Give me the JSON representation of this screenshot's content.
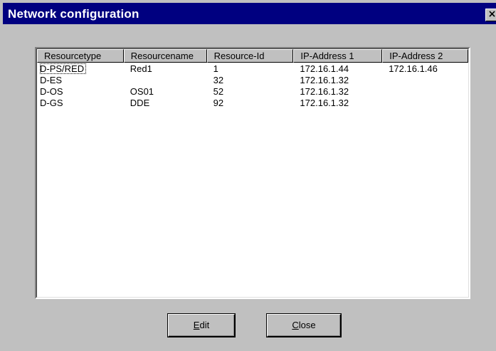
{
  "window": {
    "title": "Network configuration",
    "close_glyph": "×"
  },
  "listview": {
    "columns": [
      "Resourcetype",
      "Resourcename",
      "Resource-Id",
      "IP-Address 1",
      "IP-Address 2"
    ],
    "rows": [
      [
        "D-PS/RED",
        "Red1",
        "1",
        "172.16.1.44",
        "172.16.1.46"
      ],
      [
        "D-ES",
        "",
        "32",
        "172.16.1.32",
        ""
      ],
      [
        "D-OS",
        "OS01",
        "52",
        "172.16.1.32",
        ""
      ],
      [
        "D-GS",
        "DDE",
        "92",
        "172.16.1.32",
        ""
      ]
    ]
  },
  "buttons": {
    "edit": {
      "mnemonic": "E",
      "rest": "dit"
    },
    "close": {
      "mnemonic": "C",
      "rest": "lose"
    }
  },
  "colors": {
    "titlebar": "#000080",
    "dialog_face": "#c0c0c0",
    "list_background": "#ffffff"
  }
}
